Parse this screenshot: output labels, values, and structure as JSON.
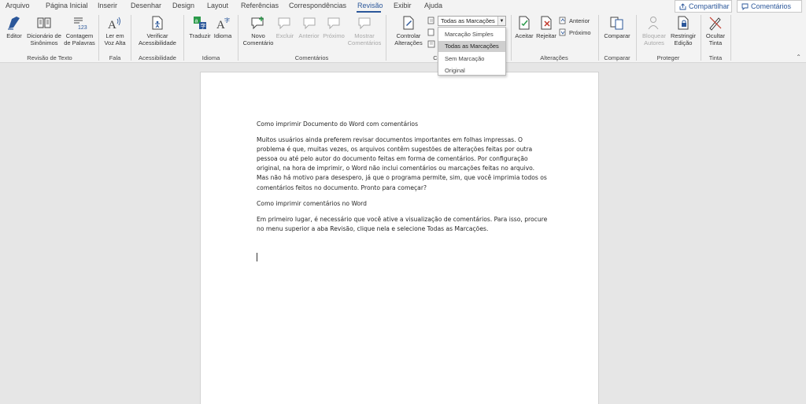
{
  "tabs": [
    "Arquivo",
    "Página Inicial",
    "Inserir",
    "Desenhar",
    "Design",
    "Layout",
    "Referências",
    "Correspondências",
    "Revisão",
    "Exibir",
    "Ajuda"
  ],
  "active_tab": "Revisão",
  "top_right": {
    "share": "Compartilhar",
    "comments": "Comentários"
  },
  "ribbon": {
    "proofing": {
      "editor": "Editor",
      "thesaurus": "Dicionário de Sinônimos",
      "word_count": "Contagem de Palavras",
      "label": "Revisão de Texto"
    },
    "speech": {
      "read_aloud": "Ler em Voz Alta",
      "label": "Fala"
    },
    "accessibility": {
      "check": "Verificar Acessibilidade",
      "label": "Acessibilidade"
    },
    "language": {
      "translate": "Traduzir",
      "language": "Idioma",
      "label": "Idioma"
    },
    "comments": {
      "new": "Novo Comentário",
      "delete": "Excluir",
      "previous": "Anterior",
      "next": "Próximo",
      "show": "Mostrar Comentários",
      "label": "Comentários"
    },
    "tracking": {
      "track": "Controlar Alterações",
      "label": "Co"
    },
    "changes": {
      "accept": "Aceitar",
      "reject": "Rejeitar",
      "previous": "Anterior",
      "next": "Próximo",
      "label": "Alterações"
    },
    "compare": {
      "compare": "Comparar",
      "label": "Comparar"
    },
    "protect": {
      "block": "Bloquear Autores",
      "restrict": "Restringir Edição",
      "label": "Proteger"
    },
    "ink": {
      "hide": "Ocultar Tinta",
      "label": "Tinta"
    }
  },
  "markup_dropdown": {
    "selected": "Todas as Marcações",
    "options": [
      "Marcação Simples",
      "Todas as Marcações",
      "Sem Marcação",
      "Original"
    ]
  },
  "document": {
    "title": "Como imprimir Documento do Word com comentários",
    "para1": "Muitos usuários ainda preferem revisar documentos importantes em folhas impressas. O problema é que, muitas vezes, os arquivos contêm sugestões de alterações feitas por outra pessoa ou até pelo autor do documento feitas em forma de comentários. Por configuração original, na hora de imprimir, o Word não inclui comentários ou marcações feitas no arquivo. Mas não há motivo para desespero, já que o programa permite, sim, que você imprimia todos os comentários feitos no documento. Pronto para começar?",
    "heading2": "Como imprimir comentários no Word",
    "para2": "Em primeiro lugar, é necessário que você ative a visualização de comentários. Para isso, procure no menu superior a aba Revisão, clique nela e selecione Todas as Marcações."
  },
  "colors": {
    "accent": "#2b579a",
    "ribbon_bg": "#f3f3f3",
    "canvas_bg": "#e6e6e6"
  },
  "icons": [
    "editor-icon",
    "thesaurus-icon",
    "word-count-icon",
    "read-aloud-icon",
    "accessibility-icon",
    "translate-icon",
    "language-icon",
    "new-comment-icon",
    "delete-comment-icon",
    "previous-comment-icon",
    "next-comment-icon",
    "show-comments-icon",
    "track-changes-icon",
    "accept-icon",
    "reject-icon",
    "compare-icon",
    "block-authors-icon",
    "restrict-editing-icon",
    "hide-ink-icon",
    "share-icon",
    "comments-icon"
  ]
}
